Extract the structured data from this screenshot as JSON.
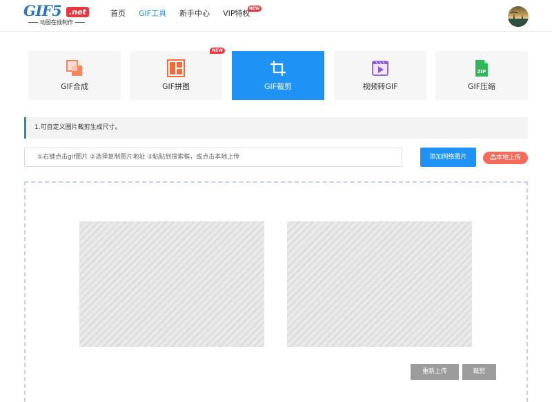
{
  "logo": {
    "main": "GIF5",
    "net": ".net",
    "tagline": "动图在线制作"
  },
  "nav": {
    "items": [
      {
        "label": "首页",
        "active": false
      },
      {
        "label": "GIF工具",
        "active": true
      },
      {
        "label": "新手中心",
        "active": false
      },
      {
        "label": "VIP特权",
        "active": false,
        "badge": "NEW"
      }
    ]
  },
  "tools": [
    {
      "label": "GIF合成",
      "icon": "merge-icon",
      "active": false
    },
    {
      "label": "GIF拼图",
      "icon": "collage-icon",
      "active": false,
      "badge": "NEW"
    },
    {
      "label": "GIF裁剪",
      "icon": "crop-icon",
      "active": true
    },
    {
      "label": "视频转GIF",
      "icon": "video-icon",
      "active": false
    },
    {
      "label": "GIF压缩",
      "icon": "zip-icon",
      "active": false,
      "icon_text": "ZIP"
    }
  ],
  "info": {
    "text": "1.可自定义图片裁剪生成尺寸。"
  },
  "search": {
    "placeholder": "①右键点击gif图片 ②选择复制图片地址 ③粘贴到搜索框，或点击本地上传",
    "value": ""
  },
  "buttons": {
    "add_network": "添加网络图片",
    "local_upload": "本地上传",
    "reupload": "重新上传",
    "crop": "裁剪"
  },
  "colors": {
    "primary": "#1f92f6",
    "accent_red": "#e8383d",
    "upload_red": "#f26b5b",
    "info_border": "#1d9b8a",
    "disabled_gray": "#9c9c9c"
  }
}
